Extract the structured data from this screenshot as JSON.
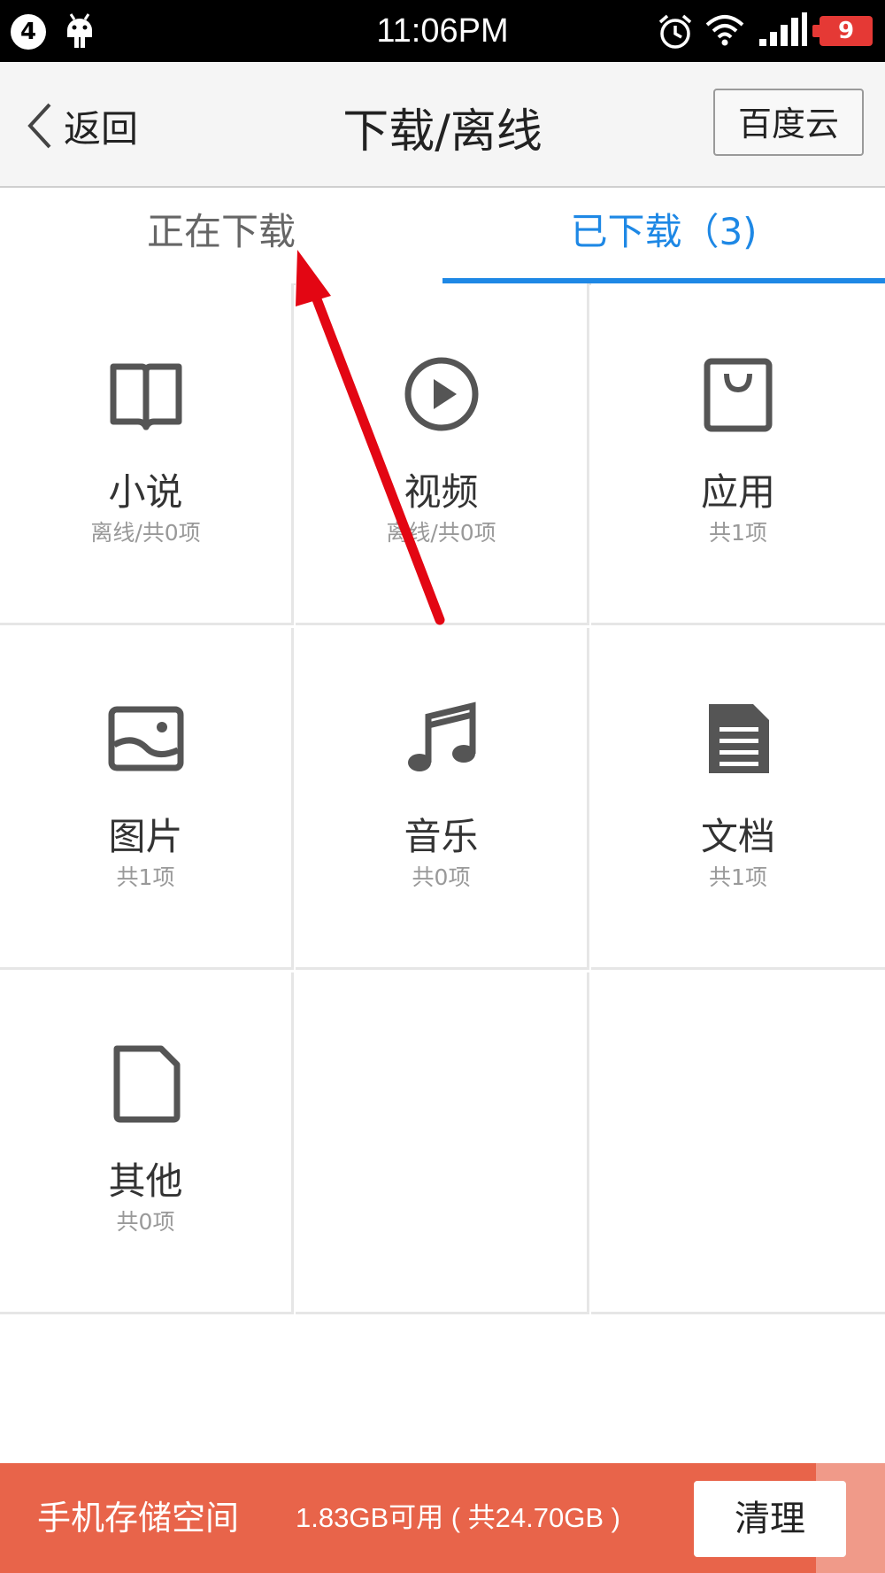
{
  "status_bar": {
    "notification_count": "4",
    "time": "11:06PM",
    "battery": "9"
  },
  "header": {
    "back_label": "返回",
    "title": "下载/离线",
    "cloud_button": "百度云"
  },
  "tabs": [
    {
      "label": "正在下载"
    },
    {
      "label": "已下载（3)"
    }
  ],
  "categories": [
    {
      "title": "小说",
      "sub": "离线/共0项",
      "icon": "book-icon"
    },
    {
      "title": "视频",
      "sub": "离线/共0项",
      "icon": "play-icon"
    },
    {
      "title": "应用",
      "sub": "共1项",
      "icon": "bag-icon"
    },
    {
      "title": "图片",
      "sub": "共1项",
      "icon": "image-icon"
    },
    {
      "title": "音乐",
      "sub": "共0项",
      "icon": "music-icon"
    },
    {
      "title": "文档",
      "sub": "共1项",
      "icon": "document-icon"
    },
    {
      "title": "其他",
      "sub": "共0项",
      "icon": "file-icon"
    }
  ],
  "bottom_bar": {
    "storage_label": "手机存储空间",
    "storage_info": "1.83GB可用 ( 共24.70GB )",
    "clean_button": "清理"
  },
  "colors": {
    "accent": "#1e88e5",
    "bottom_bar": "#e8644a",
    "annotation_arrow": "#e30613"
  }
}
